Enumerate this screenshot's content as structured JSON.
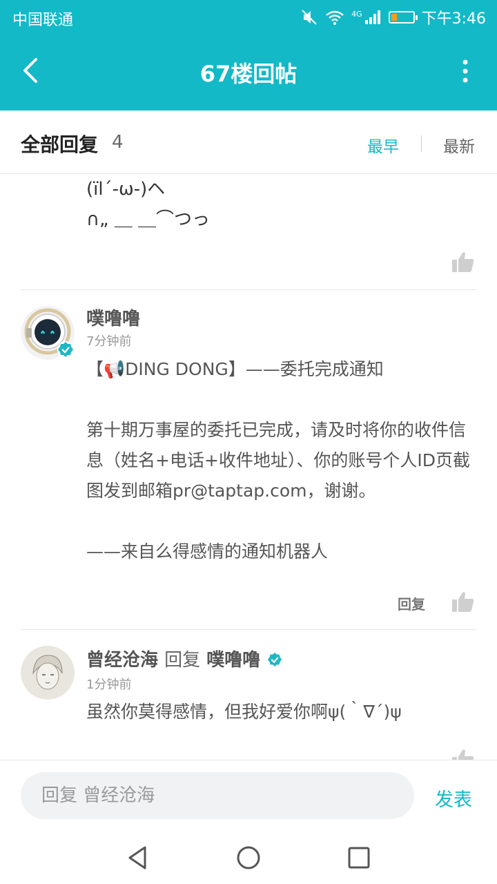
{
  "status_bar": {
    "carrier": "中国联通",
    "network": "4G",
    "time": "下午3:46",
    "battery_level": 0.25
  },
  "header": {
    "title": "67楼回帖",
    "back_icon": "chevron-left-icon",
    "more_icon": "more-vertical-icon"
  },
  "section": {
    "label": "全部回复",
    "count": "4",
    "sort_earliest": "最早",
    "sort_latest": "最新",
    "active_sort": "最早"
  },
  "posts": [
    {
      "partial": true,
      "lines": [
        "(ïl´-ω-)ヘ",
        "∩„ ＿ ＿⌒つっ"
      ]
    },
    {
      "username": "噗噜噜",
      "time": "7分钟前",
      "verified": true,
      "lines": [
        "【📢DING DONG】——委托完成通知",
        "",
        "第十期万事屋的委托已完成，请及时将你的收件信息（姓名+电话+收件地址）、你的账号个人ID页截图发到邮箱pr@taptap.com，谢谢。",
        "",
        "——来自么得感情的通知机器人"
      ],
      "reply_label": "回复"
    },
    {
      "username": "曾经沧海",
      "reply_word": "回复",
      "reply_to": "噗噜噜",
      "reply_to_verified": true,
      "time": "1分钟前",
      "text": "虽然你莫得感情，但我好爱你啊ψ(｀∇´)ψ"
    }
  ],
  "footer": {
    "input_placeholder": "回复 曾经沧海",
    "publish_label": "发表"
  },
  "colors": {
    "accent": "#14b9c8",
    "verified": "#1fb6c4"
  }
}
